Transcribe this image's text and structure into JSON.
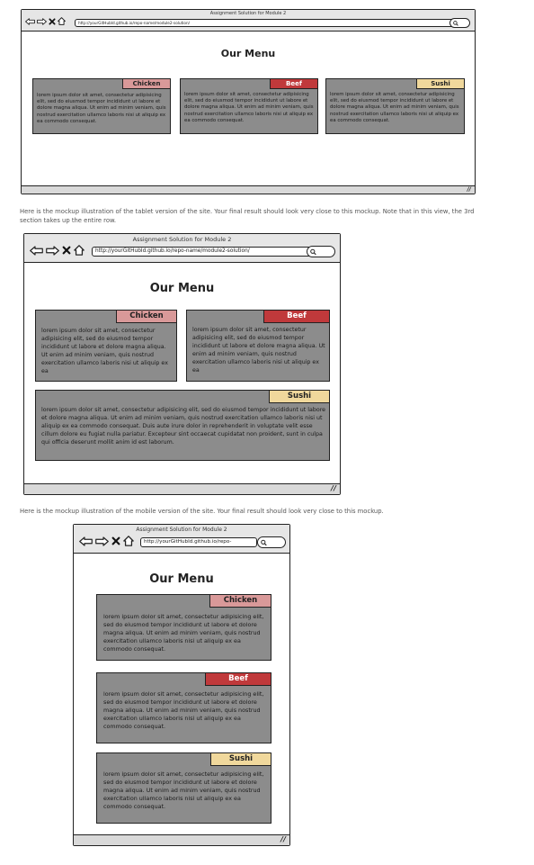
{
  "mockups": {
    "desktop": {
      "window_title": "Assignment Solution for Module 2",
      "url": "http://yourGitHubId.github.io/repo-name/module2-solution/",
      "heading": "Our Menu",
      "sections": {
        "chicken": {
          "label": "Chicken",
          "text": "lorem ipsum dolor sit amet, consectetur adipisicing elit, sed do eiusmod tempor incididunt ut labore et dolore magna aliqua. Ut enim ad minim veniam, quis nostrud exercitation ullamco laboris nisi ut aliquip ex ea commodo consequat."
        },
        "beef": {
          "label": "Beef",
          "text": "lorem ipsum dolor sit amet, consectetur adipisicing elit, sed do eiusmod tempor incididunt ut labore et dolore magna aliqua. Ut enim ad minim veniam, quis nostrud exercitation ullamco laboris nisi ut aliquip ex ea commodo consequat."
        },
        "sushi": {
          "label": "Sushi",
          "text": "lorem ipsum dolor sit amet, consectetur adipisicing elit, sed do eiusmod tempor incididunt ut labore et dolore magna aliqua. Ut enim ad minim veniam, quis nostrud exercitation ullamco laboris nisi ut aliquip ex ea commodo consequat."
        }
      }
    },
    "tablet": {
      "caption": "Here is the mockup illustration of the tablet version of the site. Your final result should look very close to this mockup. Note that in this view, the 3rd section takes up the entire row.",
      "window_title": "Assignment Solution for Module 2",
      "url": "http://yourGitHubId.github.io/repo-name/module2-solution/",
      "heading": "Our Menu",
      "sections": {
        "chicken": {
          "label": "Chicken",
          "text": "lorem ipsum dolor sit amet, consectetur adipisicing elit, sed do eiusmod tempor incididunt ut labore et dolore magna aliqua. Ut enim ad minim veniam, quis nostrud exercitation ullamco laboris nisi ut aliquip ex ea"
        },
        "beef": {
          "label": "Beef",
          "text": "lorem ipsum dolor sit amet, consectetur adipisicing elit, sed do eiusmod tempor incididunt ut labore et dolore magna aliqua. Ut enim ad minim veniam, quis nostrud exercitation ullamco laboris nisi ut aliquip ex ea"
        },
        "sushi": {
          "label": "Sushi",
          "text": "lorem ipsum dolor sit amet, consectetur adipisicing elit, sed do eiusmod tempor incididunt ut labore et dolore magna aliqua. Ut enim ad minim veniam, quis nostrud exercitation ullamco laboris nisi ut aliquip ex ea commodo consequat. Duis aute irure dolor in reprehenderit in voluptate velit esse cillum dolore eu fugiat nulla pariatur. Excepteur sint occaecat cupidatat non proident, sunt in culpa qui officia deserunt mollit anim id est laborum."
        }
      }
    },
    "mobile": {
      "caption": "Here is the mockup illustration of the mobile version of the site. Your final result should look very close to this mockup.",
      "window_title": "Assignment Solution for Module 2",
      "url": "http://yourGitHubId.github.io/repo-",
      "heading": "Our Menu",
      "sections": {
        "chicken": {
          "label": "Chicken",
          "text": "lorem ipsum dolor sit amet, consectetur adipisicing elit, sed do eiusmod tempor incididunt ut labore et dolore magna aliqua. Ut enim ad minim veniam, quis nostrud exercitation ullamco laboris nisi ut aliquip ex ea commodo consequat."
        },
        "beef": {
          "label": "Beef",
          "text": "lorem ipsum dolor sit amet, consectetur adipisicing elit, sed do eiusmod tempor incididunt ut labore et dolore magna aliqua. Ut enim ad minim veniam, quis nostrud exercitation ullamco laboris nisi ut aliquip ex ea commodo consequat."
        },
        "sushi": {
          "label": "Sushi",
          "text": "lorem ipsum dolor sit amet, consectetur adipisicing elit, sed do eiusmod tempor incididunt ut labore et dolore magna aliqua. Ut enim ad minim veniam, quis nostrud exercitation ullamco laboris nisi ut aliquip ex ea commodo consequat."
        }
      }
    }
  },
  "icons": [
    "back-arrow-icon",
    "forward-arrow-icon",
    "close-x-icon",
    "home-icon",
    "search-icon",
    "resize-grip-icon"
  ],
  "colors": {
    "chicken_label": "#d99999",
    "beef_label": "#c0393b",
    "sushi_label": "#f0d89c",
    "section_bg": "#8c8c8c",
    "status_bar": "#d9d9d9"
  }
}
